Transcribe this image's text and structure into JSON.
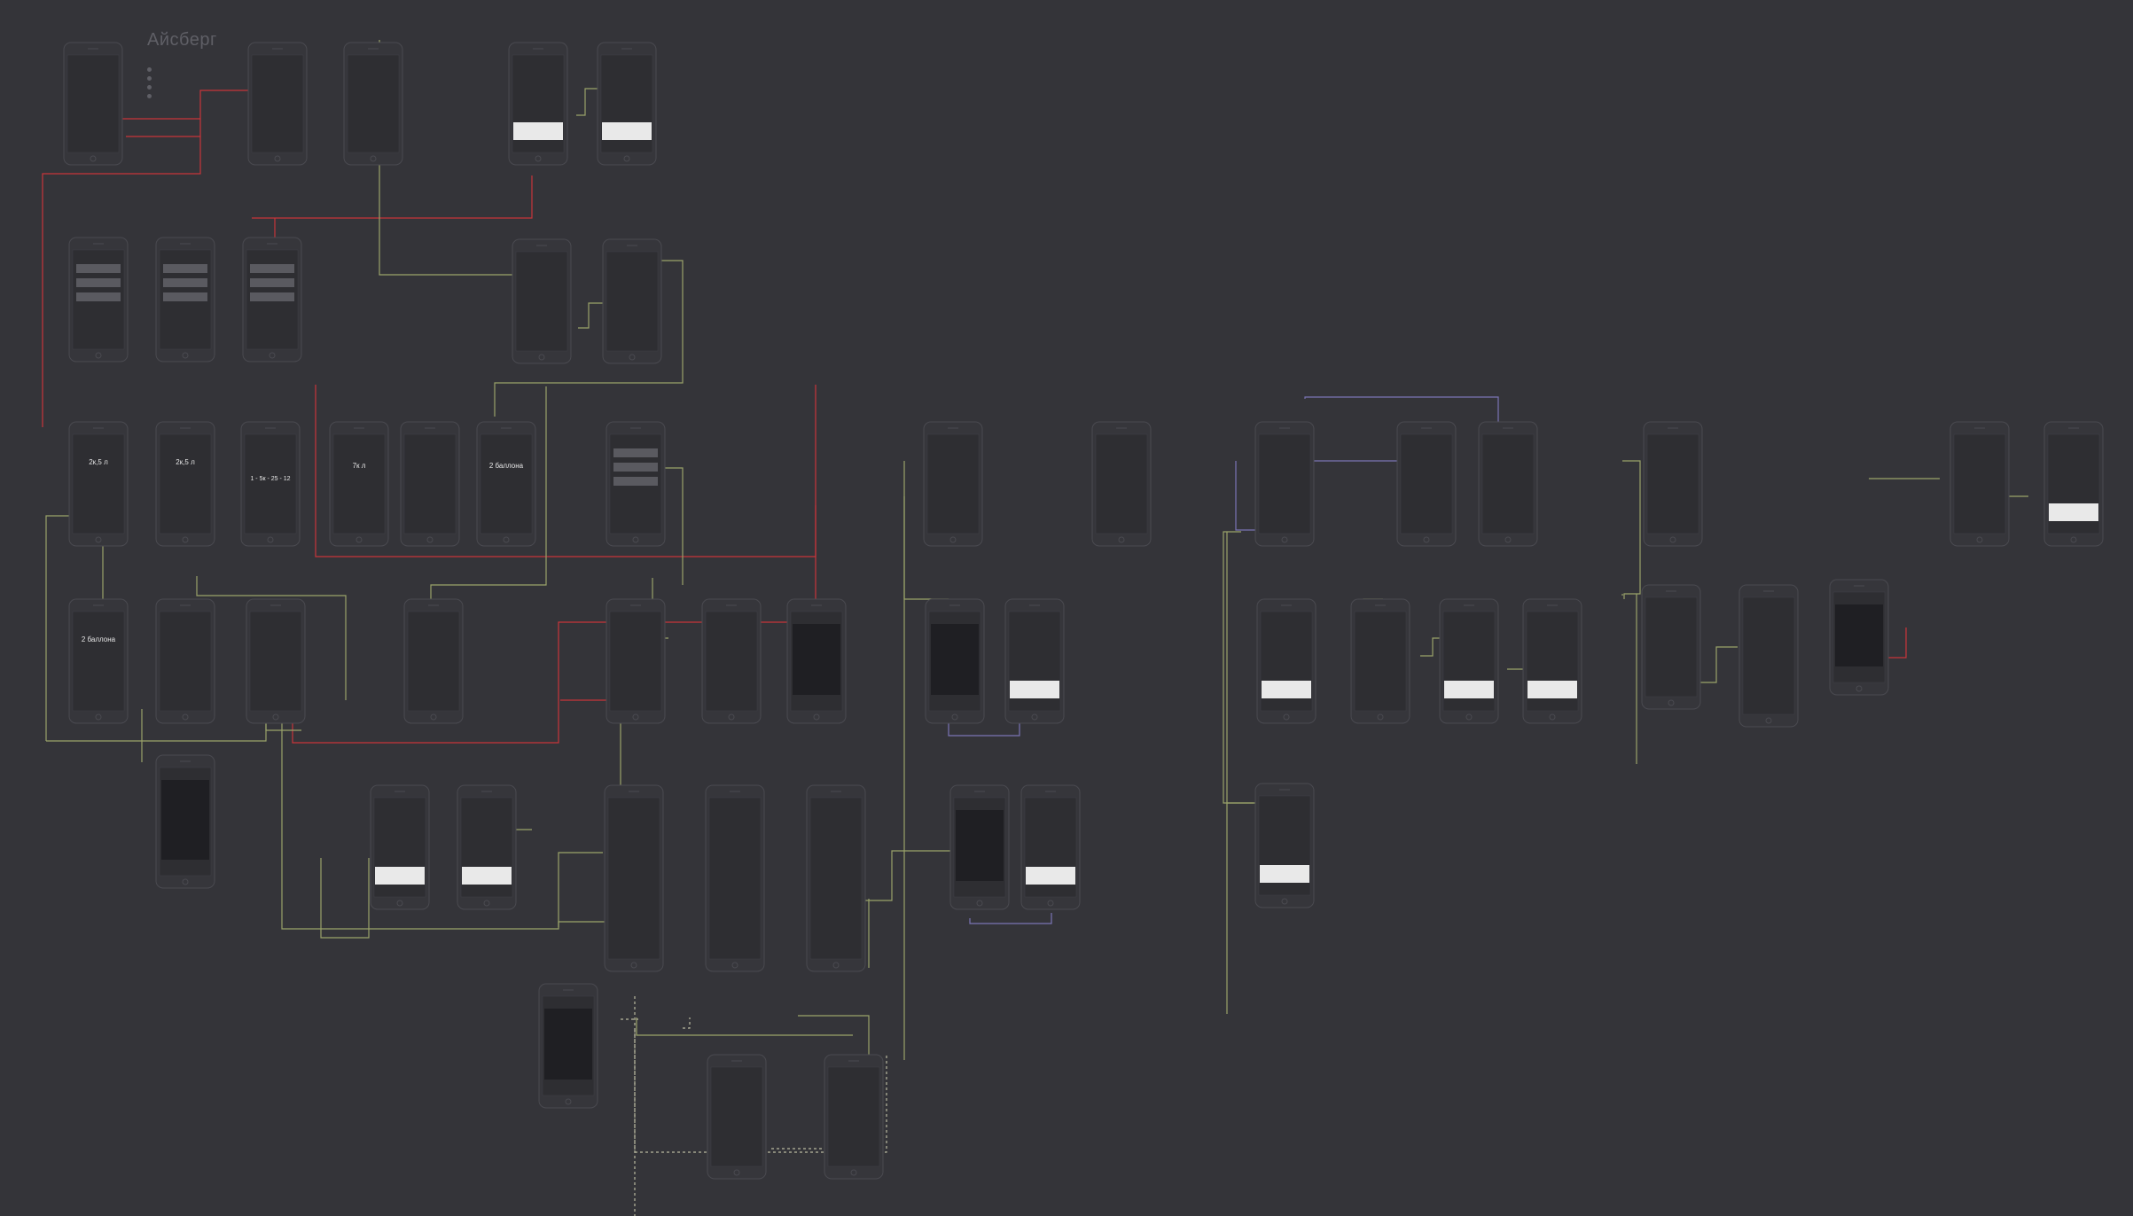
{
  "project_title": "Айсберг",
  "screen_labels": {
    "volume_a": "2к,5 л",
    "volume_b": "2к,5 л",
    "date_range": "1 - 5к - 25 - 12",
    "volume_c": "7к л",
    "bottles_a": "2 баллона",
    "bottles_b": "2 баллона"
  },
  "colors": {
    "background": "#343439",
    "phone_outline": "#4a4a50",
    "phone_fill": "#36363b",
    "screen_fill": "#2e2e32",
    "connector_red": "#c8343a",
    "connector_olive": "#9aa36a",
    "connector_purple": "#7a73b5",
    "connector_dashed": "#b9b9a0"
  }
}
